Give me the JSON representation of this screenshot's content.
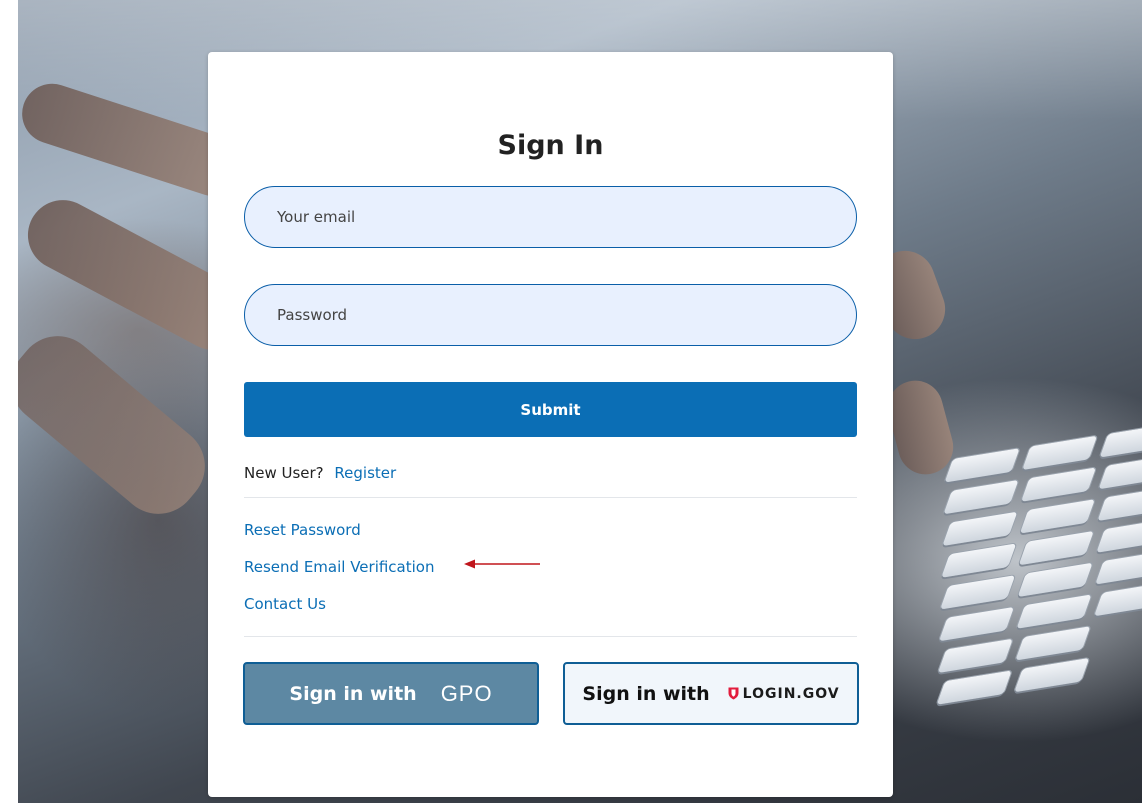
{
  "signin": {
    "title": "Sign In",
    "email_placeholder": "Your email",
    "password_placeholder": "Password",
    "submit_label": "Submit",
    "new_user_text": "New User?",
    "register_link": "Register",
    "links": {
      "reset_password": "Reset Password",
      "resend_verification": "Resend Email Verification",
      "contact_us": "Contact Us"
    },
    "sso": {
      "gpo_label": "Sign in with",
      "gpo_brand": "GPO",
      "logingov_label": "Sign in with",
      "logingov_brand": "LOGIN.GOV"
    }
  },
  "icons": {
    "annotation_arrow": "left-arrow-icon",
    "logingov_logo": "shield-icon"
  },
  "colors": {
    "primary": "#0b6eb5",
    "input_bg": "#e8f0fe",
    "input_border": "#0a5ea8",
    "gpo_button_bg": "#5d88a3",
    "logingov_button_bg": "#f1f6fb",
    "annotation_arrow": "#c0161c",
    "logingov_shield": "#e21c3d"
  }
}
